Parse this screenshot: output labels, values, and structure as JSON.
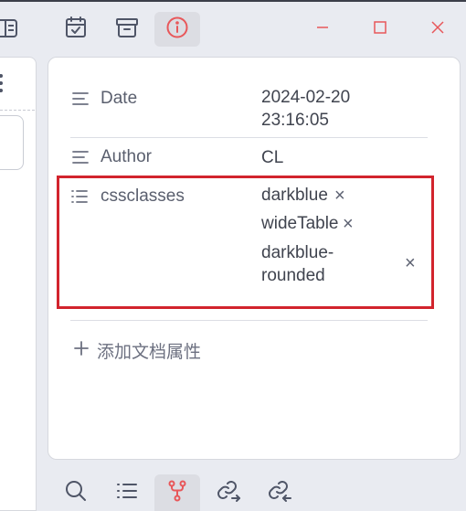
{
  "colors": {
    "accent": "#e8575a",
    "highlight_border": "#d2242d",
    "icon": "#4f5567"
  },
  "toolbar": {
    "buttons": [
      {
        "name": "calendar-icon",
        "active": false
      },
      {
        "name": "archive-icon",
        "active": false
      },
      {
        "name": "info-icon",
        "active": true
      }
    ],
    "window_controls": [
      "minimize-icon",
      "maximize-icon",
      "close-icon"
    ]
  },
  "properties": [
    {
      "key": "Date",
      "icon": "text-lines-icon",
      "value_line1": "2024-02-20",
      "value_line2": "23:16:05"
    },
    {
      "key": "Author",
      "icon": "text-lines-icon",
      "value": "CL"
    },
    {
      "key": "cssclasses",
      "icon": "list-icon",
      "tags": [
        "darkblue",
        "wideTable",
        "darkblue-",
        "rounded"
      ]
    }
  ],
  "add_property": {
    "label": "添加文档属性"
  },
  "bottom_bar": {
    "buttons": [
      {
        "name": "search-icon",
        "active": false
      },
      {
        "name": "list-icon",
        "active": false
      },
      {
        "name": "graph-icon",
        "active": true
      },
      {
        "name": "outgoing-link-icon",
        "active": false
      },
      {
        "name": "backlink-icon",
        "active": false
      }
    ]
  }
}
